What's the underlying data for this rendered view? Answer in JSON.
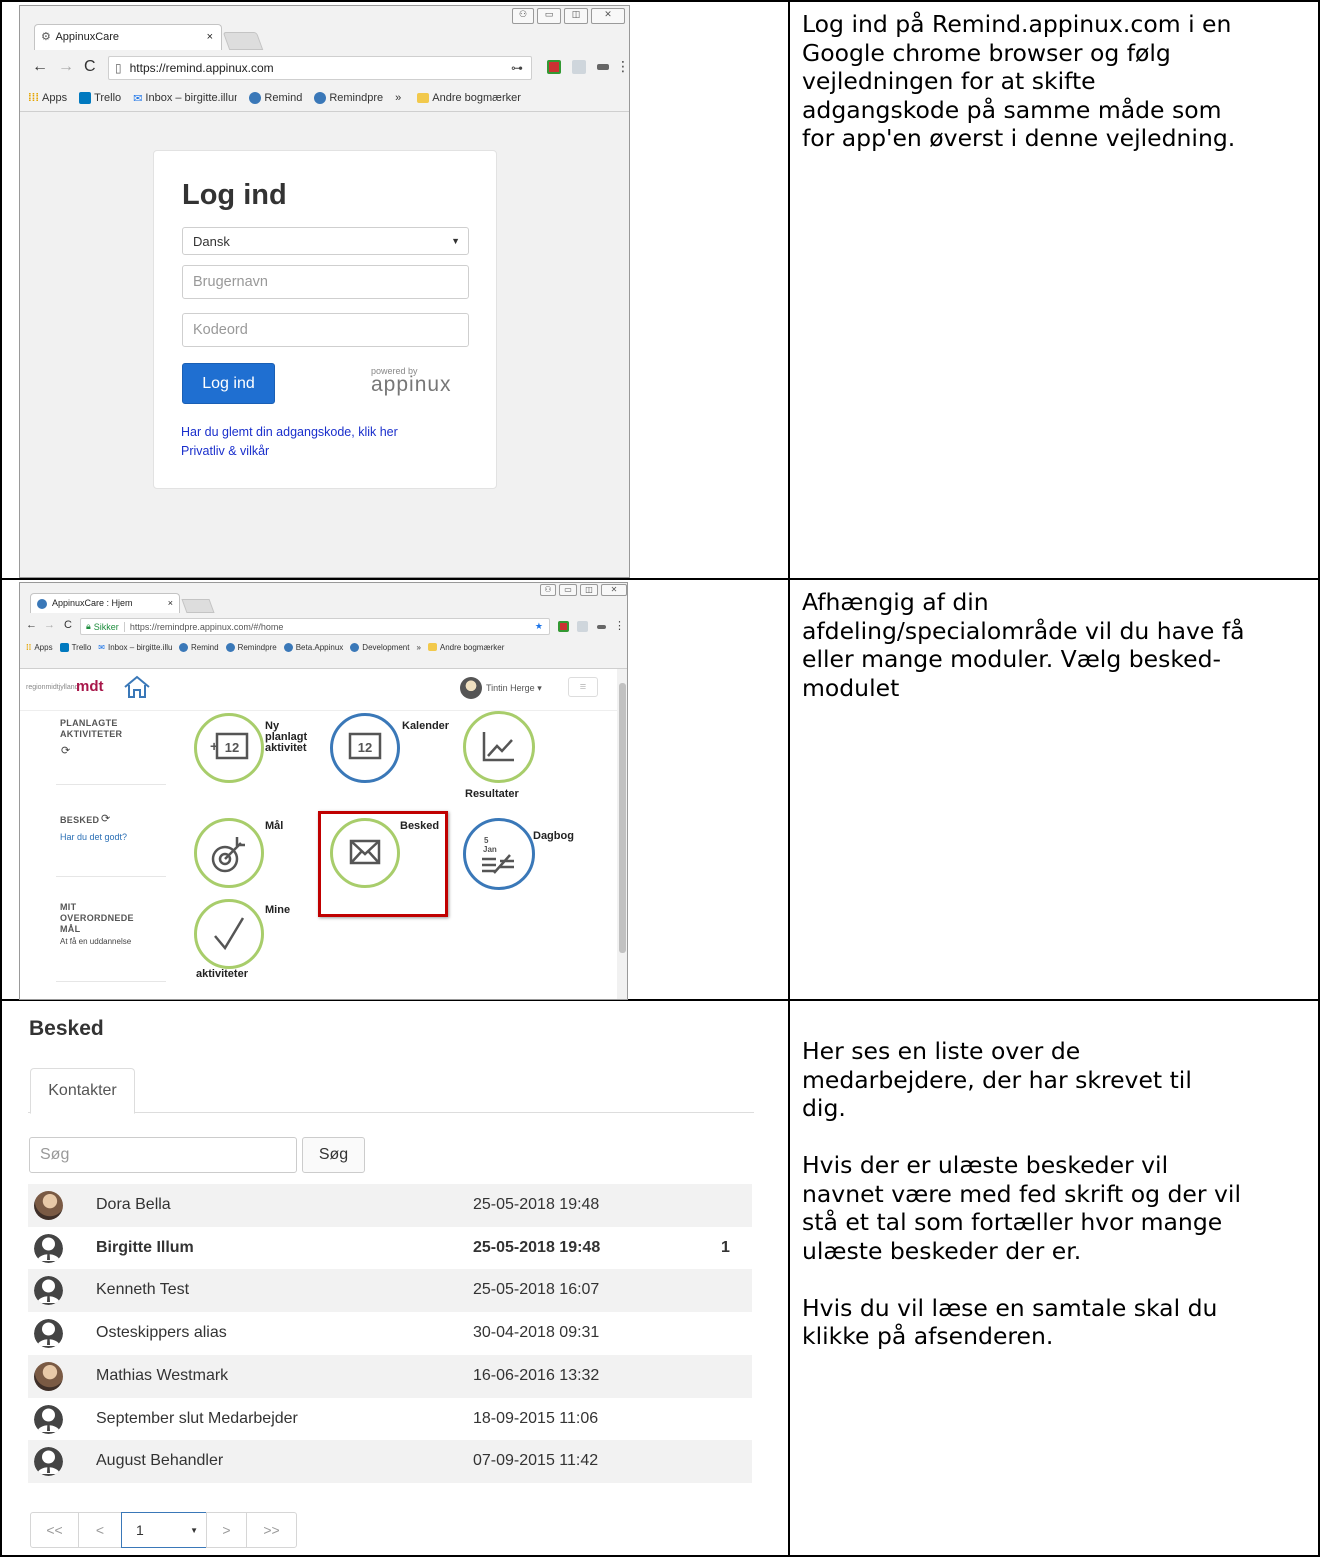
{
  "rows": [
    {
      "text": "Log ind på Remind.appinux.com i en\nGoogle chrome browser og følg\nvejledningen for at skifte\nadgangskode på samme måde som\nfor app'en øverst i denne vejledning.",
      "screenshot": {
        "tab_title": "AppinuxCare",
        "tab_close": "×",
        "url": "https://remind.appinux.com",
        "bookmarks": [
          "Apps",
          "Trello",
          "Inbox – birgitte.illum(",
          "Remind",
          "Remindpre",
          "»",
          "Andre bogmærker"
        ],
        "heading": "Log ind",
        "language": "Dansk",
        "username_placeholder": "Brugernavn",
        "password_placeholder": "Kodeord",
        "login_button": "Log ind",
        "powered_by": "powered by",
        "brand": "appinux",
        "forgot_link": "Har du glemt din adgangskode, klik her",
        "privacy_link": "Privatliv & vilkår"
      }
    },
    {
      "text": "Afhængig af din\nafdeling/specialområde vil du have få\neller mange moduler. Vælg besked-\nmodulet",
      "screenshot": {
        "tab_title": "AppinuxCare : Hjem",
        "tab_close": "×",
        "secure_label": "Sikker",
        "url": "https://remindpre.appinux.com/#/home",
        "bookmarks": [
          "Apps",
          "Trello",
          "Inbox – birgitte.illum",
          "Remind",
          "Remindpre",
          "Beta.Appinux",
          "Development",
          "»",
          "Andre bogmærker"
        ],
        "region_small": "regionmidtjylland",
        "region_big": "mdt",
        "user_name": "Tintin Herge ▾",
        "sidebar": [
          {
            "label": "PLANLAGTE\nAKTIVITETER",
            "sub": ""
          },
          {
            "label": "BESKED",
            "sub": "Har du det godt?"
          },
          {
            "label": "MIT\nOVERORDNEDE\nMÅL",
            "sub": "At få en uddannelse"
          }
        ],
        "modules": [
          {
            "label": "Ny\nplanlagt\naktivitet",
            "icon": "calendar-plus-icon",
            "color": "#a8cd6b"
          },
          {
            "label": "Kalender",
            "icon": "calendar-icon",
            "color": "#3a78b8"
          },
          {
            "label": "Resultater",
            "icon": "chart-line-icon",
            "color": "#a8cd6b"
          },
          {
            "label": "Mål",
            "icon": "target-icon",
            "color": "#a8cd6b"
          },
          {
            "label": "Besked",
            "icon": "envelope-icon",
            "color": "#a8cd6b"
          },
          {
            "label": "Dagbog",
            "icon": "diary-icon",
            "color": "#3a78b8",
            "day": "5",
            "month": "Jan"
          },
          {
            "label": "Mine",
            "label2": "aktiviteter",
            "icon": "checkmark-icon",
            "color": "#a8cd6b"
          }
        ],
        "calendar_day": "12",
        "highlight_color": "#c00000"
      }
    },
    {
      "text": "Her ses en liste over de\nmedarbejdere, der har skrevet til\ndig.\n\nHvis der er ulæste beskeder vil\nnavnet være med fed skrift og der vil\nstå et tal som fortæller hvor mange\nulæste beskeder der er.\n\nHvis du vil læse en samtale skal du\nklikke på afsenderen.",
      "screenshot": {
        "title": "Besked",
        "tab": "Kontakter",
        "search_placeholder": "Søg",
        "search_button": "Søg",
        "contacts": [
          {
            "name": "Dora Bella",
            "date": "25-05-2018 19:48",
            "unread": "",
            "bold": false,
            "avatar": "photo"
          },
          {
            "name": "Birgitte Illum",
            "date": "25-05-2018 19:48",
            "unread": "1",
            "bold": true,
            "avatar": "default"
          },
          {
            "name": "Kenneth Test",
            "date": "25-05-2018 16:07",
            "unread": "",
            "bold": false,
            "avatar": "default"
          },
          {
            "name": "Osteskippers alias",
            "date": "30-04-2018 09:31",
            "unread": "",
            "bold": false,
            "avatar": "default"
          },
          {
            "name": "Mathias Westmark",
            "date": "16-06-2016 13:32",
            "unread": "",
            "bold": false,
            "avatar": "photo"
          },
          {
            "name": "September slut Medarbejder",
            "date": "18-09-2015 11:06",
            "unread": "",
            "bold": false,
            "avatar": "default"
          },
          {
            "name": "August Behandler",
            "date": "07-09-2015 11:42",
            "unread": "",
            "bold": false,
            "avatar": "default"
          }
        ],
        "pagination": {
          "first": "<<",
          "prev": "<",
          "page": "1",
          "next": ">",
          "last": ">>"
        }
      }
    }
  ]
}
